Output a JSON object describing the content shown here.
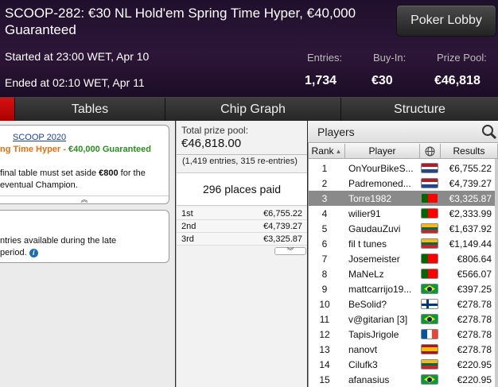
{
  "header": {
    "title": "SCOOP-282: €30 NL Hold'em Spring Time Hyper, €40,000 Guaranteed",
    "started": "Started at 23:00 WET, Apr 10",
    "ended": "Ended at 02:10 WET, Apr 11",
    "lobby_button": "Poker Lobby",
    "entries_label": "Entries:",
    "entries_value": "1,734",
    "buyin_label": "Buy-In:",
    "buyin_value": "€30",
    "prizepool_label": "Prize Pool:",
    "prizepool_value": "€46,818"
  },
  "tabs": [
    "Tables",
    "Chip Graph",
    "Structure"
  ],
  "info": {
    "scoop_link": "SCOOP 2020",
    "hyper_text": "ng Time Hyper",
    "dash": " - ",
    "guaranteed_text": "€40,000 Guaranteed",
    "note_line1_a": "final table must set aside ",
    "note_line1_b": "€800",
    "note_line1_c": " for the",
    "note_line2": "eventual Champion.",
    "late_line1": "ntries available during the late",
    "late_line2": "period."
  },
  "prize": {
    "total_label": "Total prize pool:",
    "total_value": "€46,818.00",
    "entries": "(1,419 entries, 315 re-entries)",
    "places": "296 places paid",
    "payouts": [
      {
        "place": "1st",
        "amount": "€6,755.22"
      },
      {
        "place": "2nd",
        "amount": "€4,739.27"
      },
      {
        "place": "3rd",
        "amount": "€3,325.87"
      }
    ]
  },
  "players": {
    "title": "Players",
    "col_rank": "Rank",
    "col_player": "Player",
    "col_results": "Results",
    "rows": [
      {
        "rank": "1",
        "name": "OnYourBikeS...",
        "flag": "nl",
        "result": "€6,755.22"
      },
      {
        "rank": "2",
        "name": "Padremoned...",
        "flag": "nl",
        "result": "€4,739.27"
      },
      {
        "rank": "3",
        "name": "Torre1982",
        "flag": "pt",
        "result": "€3,325.87"
      },
      {
        "rank": "4",
        "name": "wilier91",
        "flag": "pt",
        "result": "€2,333.99"
      },
      {
        "rank": "5",
        "name": "GaudauZuvi",
        "flag": "lt",
        "result": "€1,637.92"
      },
      {
        "rank": "6",
        "name": "fil t tunes",
        "flag": "lt",
        "result": "€1,149.44"
      },
      {
        "rank": "7",
        "name": "Josemeister",
        "flag": "pt",
        "result": "€806.64"
      },
      {
        "rank": "8",
        "name": "MaNeLz",
        "flag": "pt",
        "result": "€566.07"
      },
      {
        "rank": "9",
        "name": "mattcarrijo19...",
        "flag": "br",
        "result": "€397.25"
      },
      {
        "rank": "10",
        "name": "BeSolid?",
        "flag": "fi",
        "result": "€278.78"
      },
      {
        "rank": "11",
        "name": "v@gitarian [3]",
        "flag": "br",
        "result": "€278.78"
      },
      {
        "rank": "12",
        "name": "TapisJrigole",
        "flag": "fr",
        "result": "€278.78"
      },
      {
        "rank": "13",
        "name": "nanovt",
        "flag": "es",
        "result": "€278.78"
      },
      {
        "rank": "14",
        "name": "Cilufk3",
        "flag": "lt",
        "result": "€220.95"
      },
      {
        "rank": "15",
        "name": "afanasius",
        "flag": "br",
        "result": "€220.95"
      }
    ],
    "selected_rank": "3"
  },
  "colors": {
    "accent_red": "#d81010",
    "header_bg": "#2d1638",
    "hyper_orange": "#e07010",
    "guaranteed_green": "#2a8e1e"
  }
}
